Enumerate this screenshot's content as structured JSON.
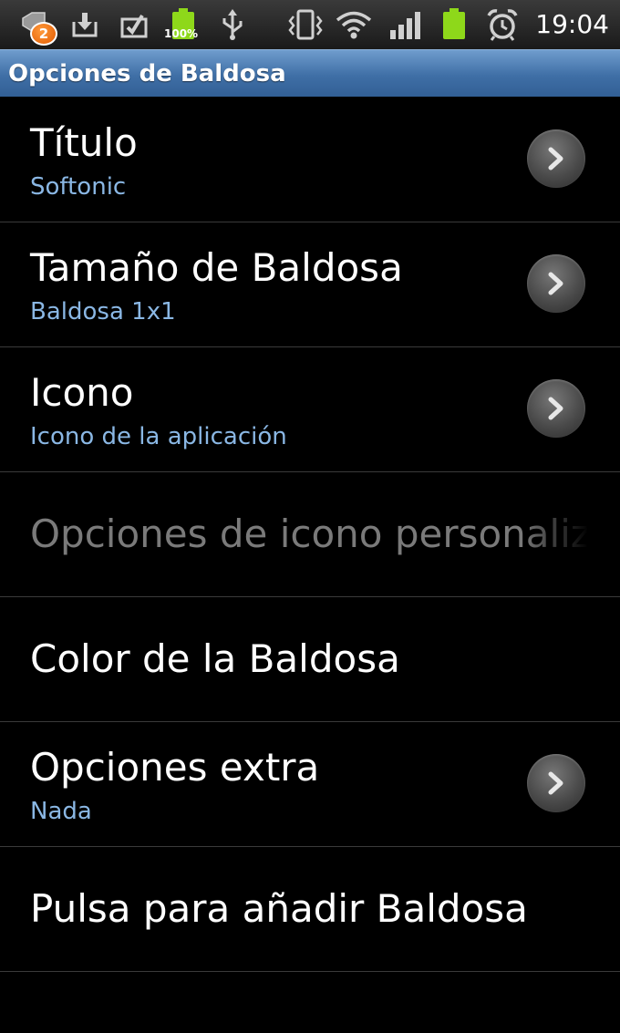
{
  "status_bar": {
    "notification_count": "2",
    "battery_percent": "100%",
    "time": "19:04",
    "icons": [
      "notification-icon",
      "download-icon",
      "checkmark-icon",
      "battery-charging-icon",
      "usb-icon",
      "vibrate-icon",
      "wifi-icon",
      "signal-icon",
      "battery-icon",
      "alarm-icon"
    ]
  },
  "header": {
    "title": "Opciones de Baldosa"
  },
  "settings": [
    {
      "title": "Título",
      "subtitle": "Softonic",
      "has_chevron": true
    },
    {
      "title": "Tamaño de Baldosa",
      "subtitle": "Baldosa 1x1",
      "has_chevron": true
    },
    {
      "title": "Icono",
      "subtitle": "Icono de la aplicación",
      "has_chevron": true
    },
    {
      "title": "Opciones de icono personalizado",
      "enabled": false
    },
    {
      "title": "Color de la Baldosa"
    },
    {
      "title": "Opciones extra",
      "subtitle": "Nada",
      "has_chevron": true
    },
    {
      "title": "Pulsa para añadir Baldosa"
    }
  ],
  "colors": {
    "title_bar": "#4a78ad",
    "subtitle": "#8ab7e4",
    "battery_green": "#8ed81a",
    "notification_orange": "#f07a1a"
  }
}
